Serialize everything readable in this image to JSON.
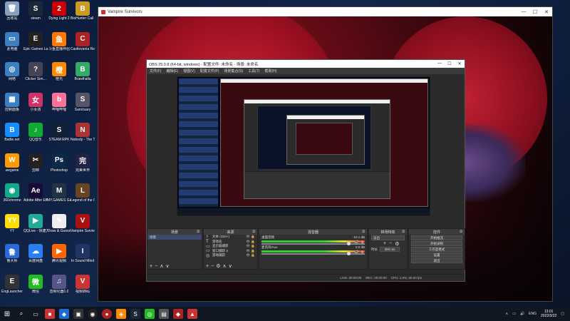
{
  "desktop_icons": [
    {
      "label": "回收站",
      "color": "#8aa0c0",
      "glyph": "🗑"
    },
    {
      "label": "steam",
      "color": "#1b2838",
      "glyph": "S"
    },
    {
      "label": "Dying Light 2",
      "color": "#c00",
      "glyph": "2"
    },
    {
      "label": "BioHunter Call of ...",
      "color": "#c92",
      "glyph": "B"
    },
    {
      "label": "此电脑",
      "color": "#3a7fc1",
      "glyph": "▭"
    },
    {
      "label": "Epic Games Launcher",
      "color": "#222",
      "glyph": "E"
    },
    {
      "label": "斗鱼直播伴侣",
      "color": "#f70",
      "glyph": "鱼"
    },
    {
      "label": "Castlevania Recharged",
      "color": "#a22",
      "glyph": "C"
    },
    {
      "label": "网络",
      "color": "#3a7fc1",
      "glyph": "◎"
    },
    {
      "label": "Clicker Sim...",
      "color": "#445",
      "glyph": "?"
    },
    {
      "label": "橙光",
      "color": "#f80",
      "glyph": "橙"
    },
    {
      "label": "Brawlhalla",
      "color": "#3a6",
      "glyph": "B"
    },
    {
      "label": "控制面板",
      "color": "#3a7fc1",
      "glyph": "▦"
    },
    {
      "label": "小女孩",
      "color": "#c36",
      "glyph": "女"
    },
    {
      "label": "哔哩哔哩",
      "color": "#fb7299",
      "glyph": "b"
    },
    {
      "label": "Sanctuary",
      "color": "#556",
      "glyph": "S"
    },
    {
      "label": "Battle.net",
      "color": "#148eff",
      "glyph": "B"
    },
    {
      "label": "QQ音乐",
      "color": "#1a3",
      "glyph": "♪"
    },
    {
      "label": "STEAM RPK",
      "color": "#123",
      "glyph": "S"
    },
    {
      "label": "Nobody - The Turnaround",
      "color": "#a33",
      "glyph": "N"
    },
    {
      "label": "wegame",
      "color": "#f90",
      "glyph": "W"
    },
    {
      "label": "剪映",
      "color": "#222",
      "glyph": "✂"
    },
    {
      "label": "Photoshop",
      "color": "#0a2a4a",
      "glyph": "Ps"
    },
    {
      "label": "完美世界",
      "color": "#224",
      "glyph": "完"
    },
    {
      "label": "360chrome",
      "color": "#1a8",
      "glyph": "◉"
    },
    {
      "label": "Adobe After Effects CC",
      "color": "#1a0a3a",
      "glyph": "Ae"
    },
    {
      "label": "MY.GAMES GameCenter",
      "color": "#234",
      "glyph": "M"
    },
    {
      "label": "Legend of the Outlaw",
      "color": "#642",
      "glyph": "L"
    },
    {
      "label": "YY",
      "color": "#fd0",
      "glyph": "YY"
    },
    {
      "label": "QQLive - 快捷方式",
      "color": "#2a9",
      "glyph": "▶"
    },
    {
      "label": "Draw & Guess",
      "color": "#eee",
      "glyph": "✎"
    },
    {
      "label": "Vampire Survivors",
      "color": "#a11",
      "glyph": "V"
    },
    {
      "label": "鲁大师",
      "color": "#2a6ad8",
      "glyph": "鲁"
    },
    {
      "label": "百度网盘",
      "color": "#2a7ef0",
      "glyph": "☁"
    },
    {
      "label": "腾讯视频",
      "color": "#f60",
      "glyph": "▶"
    },
    {
      "label": "In Sound Mind",
      "color": "#236",
      "glyph": "I"
    },
    {
      "label": "EngLauncher",
      "color": "#333",
      "glyph": "E"
    },
    {
      "label": "微信",
      "color": "#2b2",
      "glyph": "微"
    },
    {
      "label": "音频化器1.0",
      "color": "#558",
      "glyph": "♫"
    },
    {
      "label": "视频转码",
      "color": "#c33",
      "glyph": "V"
    }
  ],
  "game_window": {
    "title": "Vampire Survivors",
    "minimize": "—",
    "maximize": "☐",
    "close": "✕"
  },
  "obs": {
    "title": "OBS 25.0.8 (64-bit, windows) - 配置文件: 未命名 - 场景: 未命名",
    "menu": [
      "文件(F)",
      "编辑(E)",
      "视图(V)",
      "配置文件(P)",
      "场景集合(S)",
      "工具(T)",
      "帮助(H)"
    ],
    "docks": {
      "scenes": {
        "title": "场景",
        "items": [
          "场景"
        ]
      },
      "sources": {
        "title": "来源",
        "items": [
          {
            "label": "文本 (GDI+)",
            "icon": "T"
          },
          {
            "label": "游戏名",
            "icon": "T"
          },
          {
            "label": "显示器捕获",
            "icon": "▭"
          },
          {
            "label": "窗口捕获 3",
            "icon": "▭"
          },
          {
            "label": "游戏捕获",
            "icon": "◎"
          }
        ]
      },
      "mixer": {
        "title": "混音器",
        "channels": [
          {
            "name": "桌面音频",
            "db": "-10.1 dB"
          },
          {
            "name": "麦克风/Aux",
            "db": "0.0 dB"
          }
        ]
      },
      "transitions": {
        "title": "转场特效",
        "type": "淡出",
        "duration_label": "时长",
        "duration": "300 ms"
      },
      "controls": {
        "title": "控件",
        "buttons": [
          "开始推流",
          "开始录制",
          "工作室模式",
          "设置",
          "退出"
        ]
      }
    },
    "status": {
      "live": "LIVE: 00:00:00",
      "rec": "REC: 00:00:00",
      "cpu": "CPU: 1.0%, 60.00 fps"
    }
  },
  "taskbar": {
    "tray_lang": "ENG",
    "time": "13:01",
    "date": "2022/3/22"
  }
}
